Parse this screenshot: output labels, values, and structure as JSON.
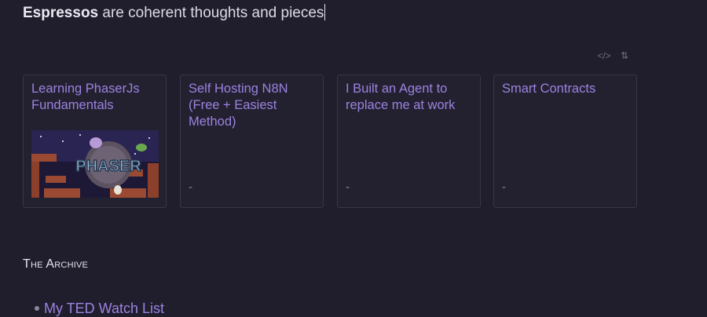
{
  "intro": {
    "bold": "Espressos",
    "rest": " are coherent thoughts and pieces"
  },
  "toolbar": {
    "embed_icon": "</>",
    "sort_icon": "⇅"
  },
  "cards": [
    {
      "title": "Learning PhaserJs Fundamentals",
      "thumbnail_text": "PHASER",
      "dash": ""
    },
    {
      "title": "Self Hosting N8N (Free + Easiest Method)",
      "dash": "-"
    },
    {
      "title": "I Built an Agent to replace me at work",
      "dash": "-"
    },
    {
      "title": "Smart Contracts",
      "dash": "-"
    }
  ],
  "archive": {
    "heading": "The Archive",
    "items": [
      {
        "label": "My TED Watch List"
      }
    ]
  },
  "colors": {
    "background": "#201e2d",
    "link": "#9c82e0",
    "card_border": "#383546"
  }
}
